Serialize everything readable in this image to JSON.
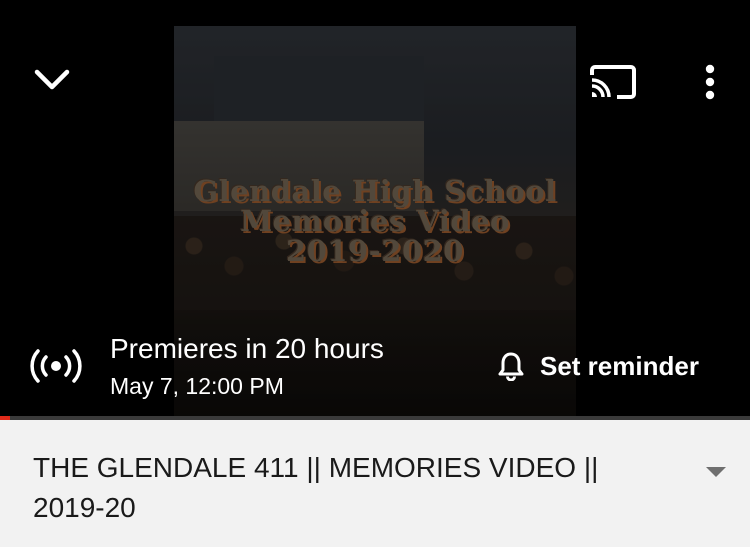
{
  "player": {
    "thumbnail": {
      "title_lines": [
        "Glendale High School",
        "Memories Video",
        "2019-2020"
      ]
    },
    "top_bar": {
      "collapse_icon": "chevron-down-icon",
      "cast_icon": "cast-icon",
      "more_icon": "more-vert-icon"
    },
    "premiere": {
      "icon": "live-broadcast-icon",
      "status": "Premieres in 20 hours",
      "datetime": "May 7, 12:00 PM"
    },
    "reminder": {
      "icon": "bell-icon",
      "label": "Set reminder"
    },
    "progress_fraction": 0.013
  },
  "info": {
    "title": "THE GLENDALE 411 || MEMORIES VIDEO || 2019-20",
    "expand_icon": "triangle-down-icon"
  },
  "colors": {
    "background": "#000000",
    "panel": "#f2f2f2",
    "progress": "#e02a1a",
    "text_light": "#ffffff",
    "text_dark": "#1a1a1a"
  }
}
